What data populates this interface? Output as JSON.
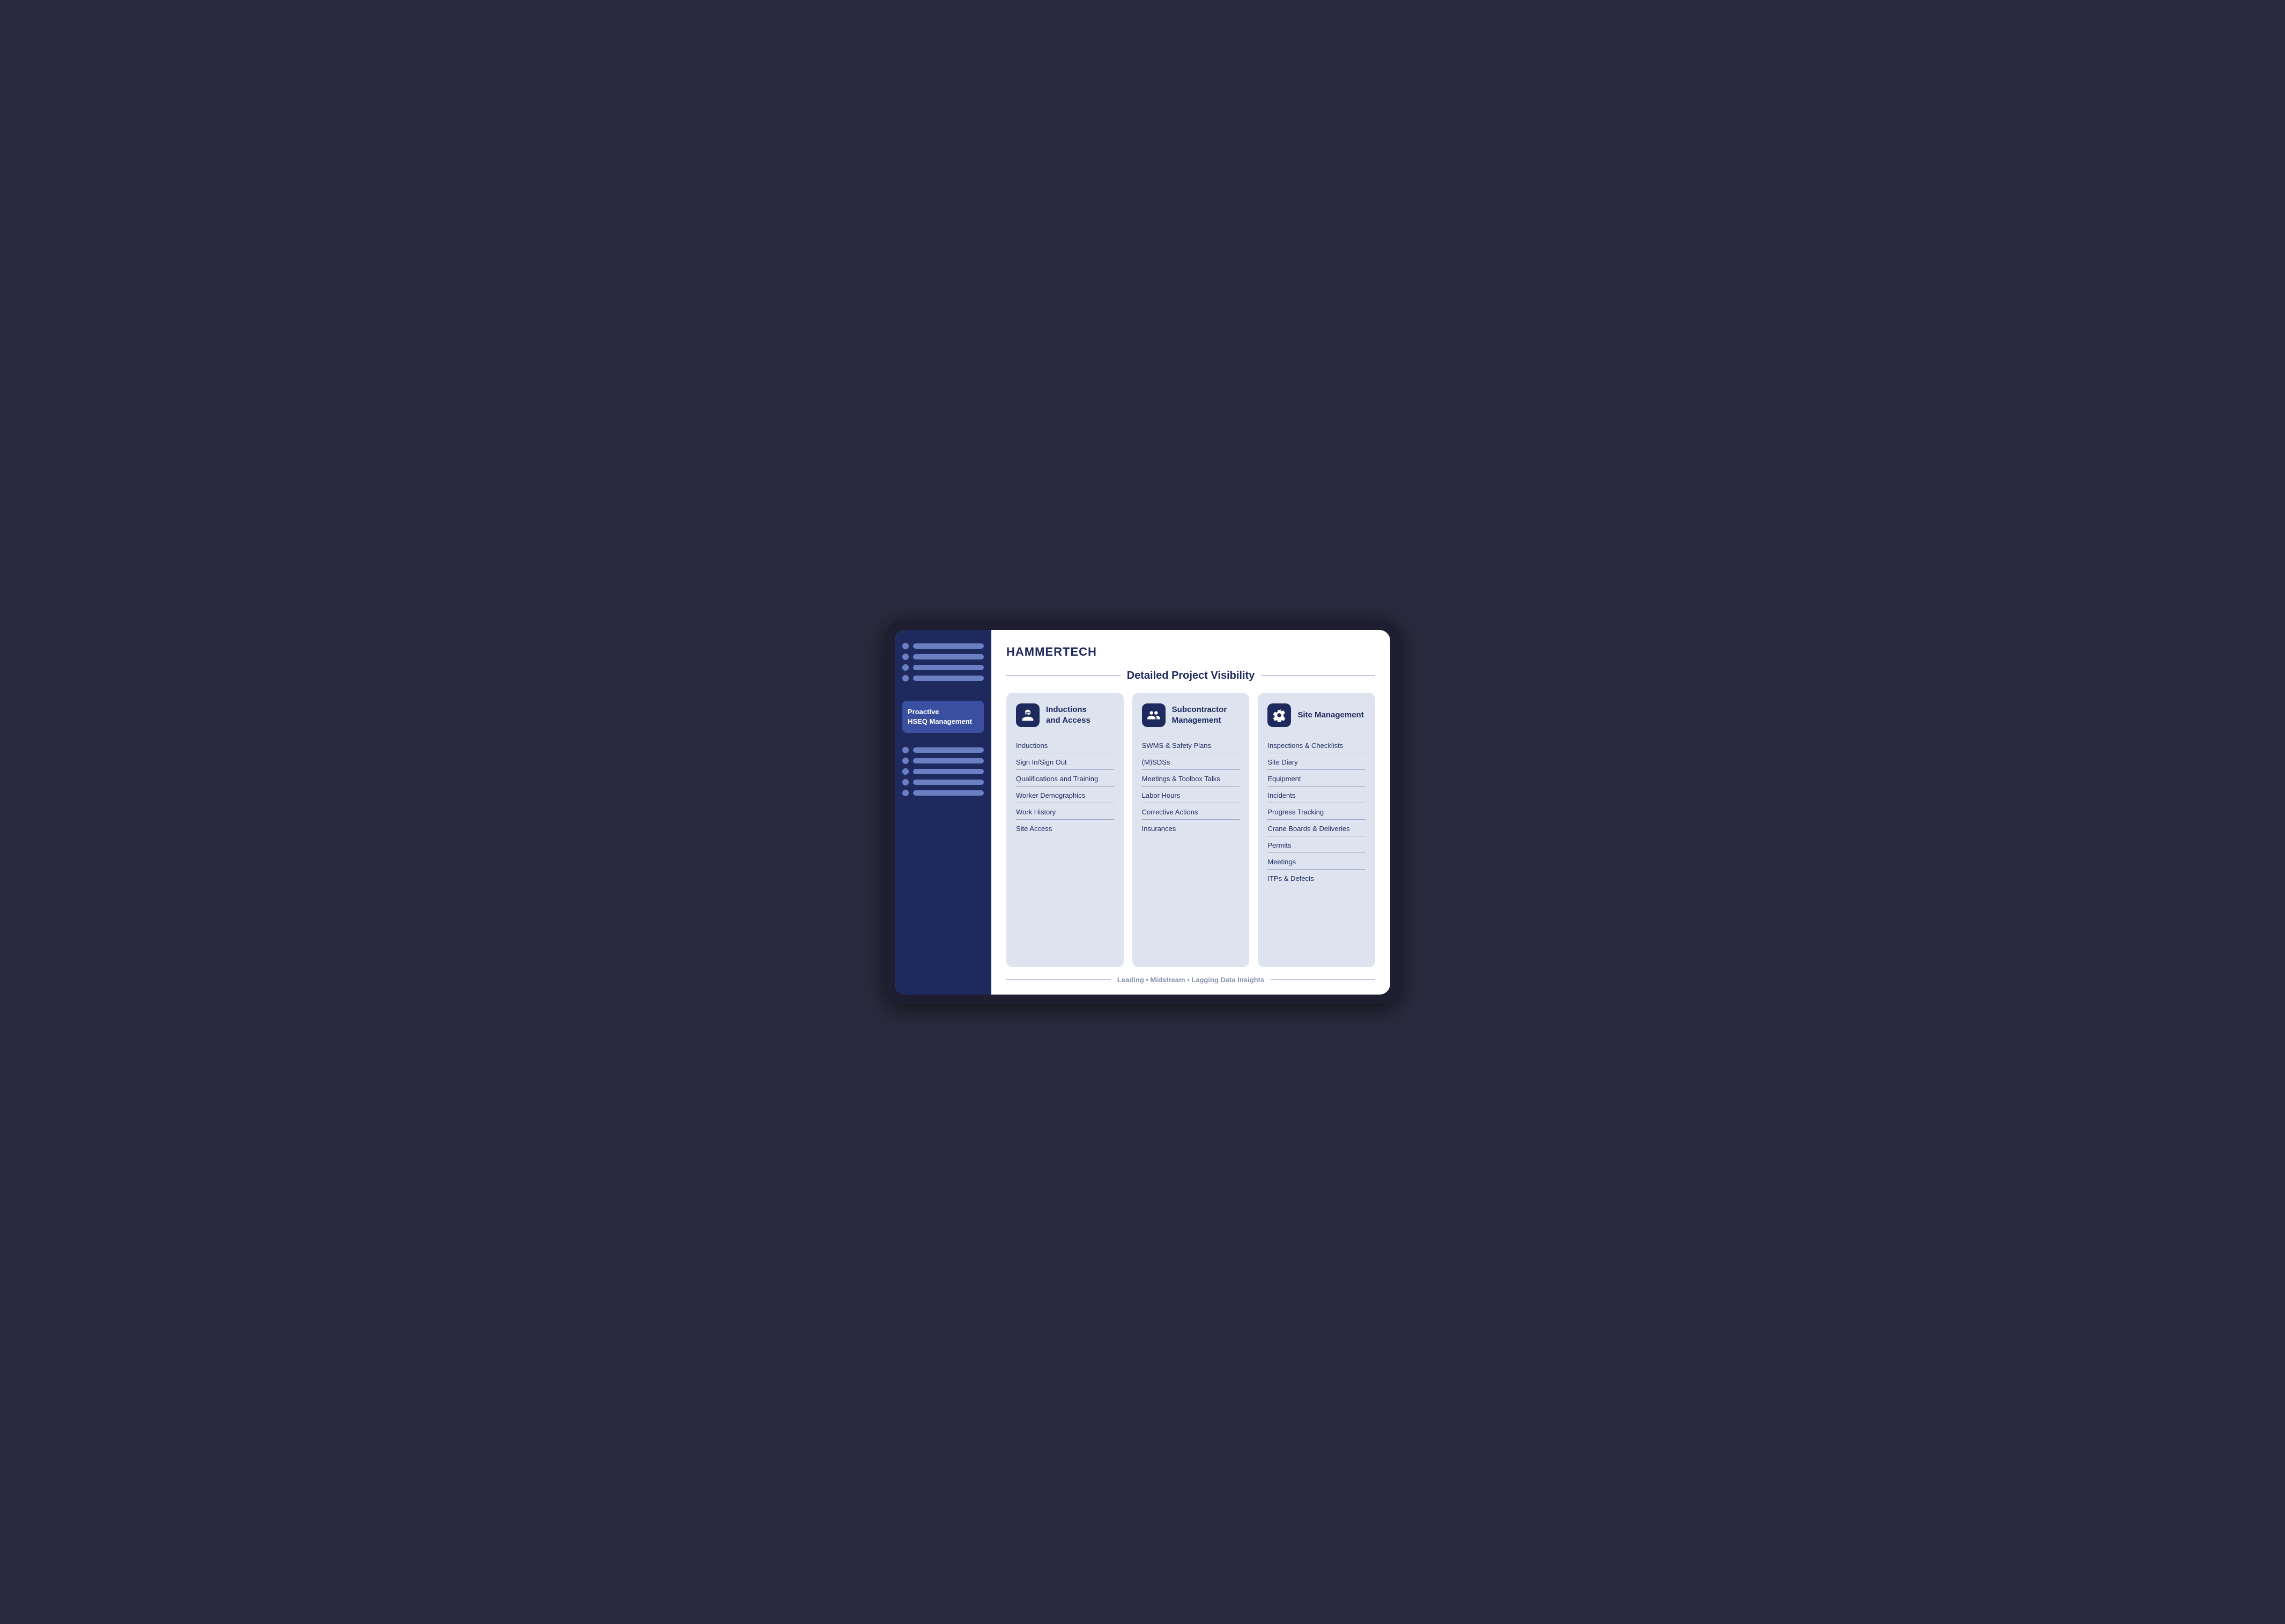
{
  "logo": "HAMMERTECH",
  "section_title": "Detailed Project Visibility",
  "footer_text": "Leading  •  Midstream  •  Lagging Data Insights",
  "sidebar": {
    "active_label": "Proactive\nHSEQ Management",
    "top_items": [
      {
        "bar_width": "70%"
      },
      {
        "bar_width": "55%"
      },
      {
        "bar_width": "65%"
      },
      {
        "bar_width": "50%"
      }
    ],
    "bottom_items": [
      {
        "bar_width": "70%"
      },
      {
        "bar_width": "55%"
      },
      {
        "bar_width": "65%"
      },
      {
        "bar_width": "50%"
      },
      {
        "bar_width": "60%"
      }
    ]
  },
  "cards": [
    {
      "id": "inductions",
      "title": "Inductions\nand Access",
      "items": [
        "Inductions",
        "Sign In/Sign Out",
        "Qualifications and Training",
        "Worker Demographics",
        "Work History",
        "Site Access"
      ]
    },
    {
      "id": "subcontractor",
      "title": "Subcontractor\nManagement",
      "items": [
        "SWMS & Safety Plans",
        "(M)SDSs",
        "Meetings & Toolbox Talks",
        "Labor Hours",
        "Corrective Actions",
        "Insurances"
      ]
    },
    {
      "id": "site",
      "title": "Site Management",
      "items": [
        "Inspections & Checklists",
        "Site Diary",
        "Equipment",
        "Incidents",
        "Progress Tracking",
        "Crane Boards & Deliveries",
        "Permits",
        "Meetings",
        "ITPs & Defects"
      ]
    }
  ]
}
